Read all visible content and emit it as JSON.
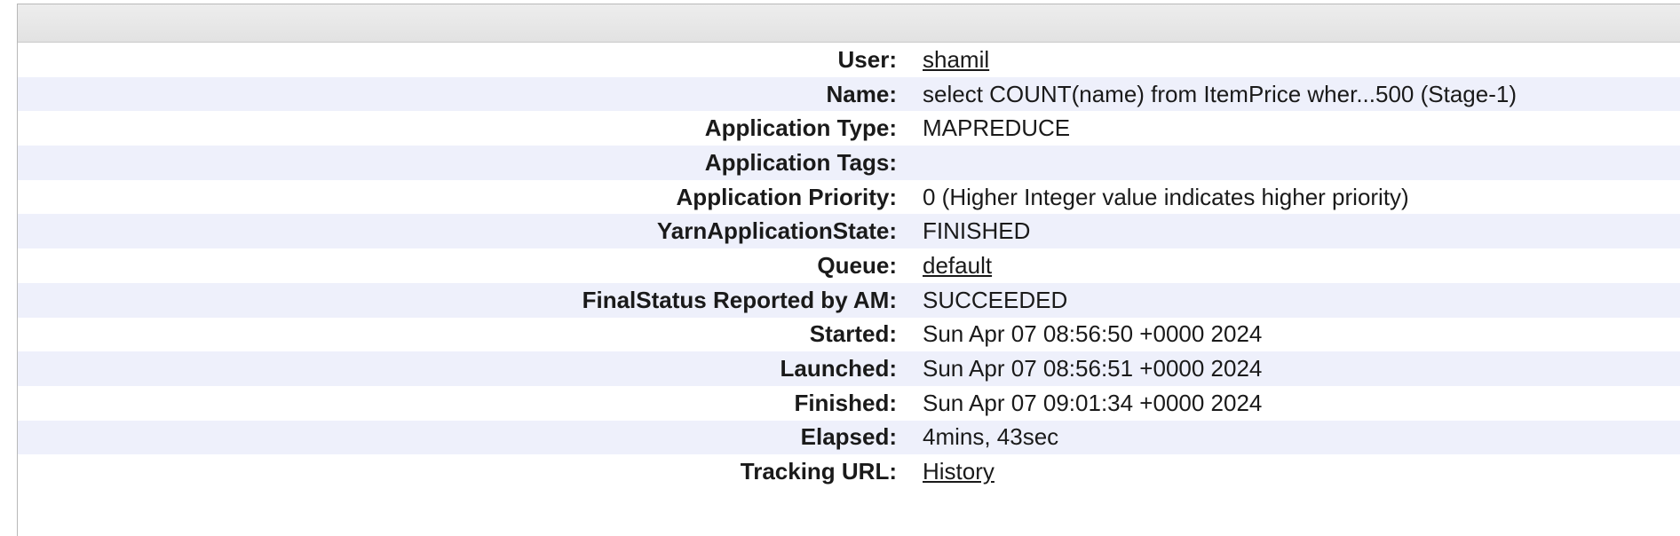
{
  "overview": {
    "rows": [
      {
        "key": "user",
        "label": "User:",
        "value": "shamil",
        "link": true
      },
      {
        "key": "name",
        "label": "Name:",
        "value": "select COUNT(name) from ItemPrice wher...500 (Stage-1)",
        "link": false
      },
      {
        "key": "application-type",
        "label": "Application Type:",
        "value": "MAPREDUCE",
        "link": false
      },
      {
        "key": "application-tags",
        "label": "Application Tags:",
        "value": "",
        "link": false
      },
      {
        "key": "application-priority",
        "label": "Application Priority:",
        "value": "0 (Higher Integer value indicates higher priority)",
        "link": false
      },
      {
        "key": "yarn-application-state",
        "label": "YarnApplicationState:",
        "value": "FINISHED",
        "link": false
      },
      {
        "key": "queue",
        "label": "Queue:",
        "value": "default",
        "link": true
      },
      {
        "key": "final-status",
        "label": "FinalStatus Reported by AM:",
        "value": "SUCCEEDED",
        "link": false
      },
      {
        "key": "started",
        "label": "Started:",
        "value": "Sun Apr 07 08:56:50 +0000 2024",
        "link": false
      },
      {
        "key": "launched",
        "label": "Launched:",
        "value": "Sun Apr 07 08:56:51 +0000 2024",
        "link": false
      },
      {
        "key": "finished",
        "label": "Finished:",
        "value": "Sun Apr 07 09:01:34 +0000 2024",
        "link": false
      },
      {
        "key": "elapsed",
        "label": "Elapsed:",
        "value": "4mins, 43sec",
        "link": false
      },
      {
        "key": "tracking-url",
        "label": "Tracking URL:",
        "value": "History",
        "link": true
      }
    ]
  }
}
